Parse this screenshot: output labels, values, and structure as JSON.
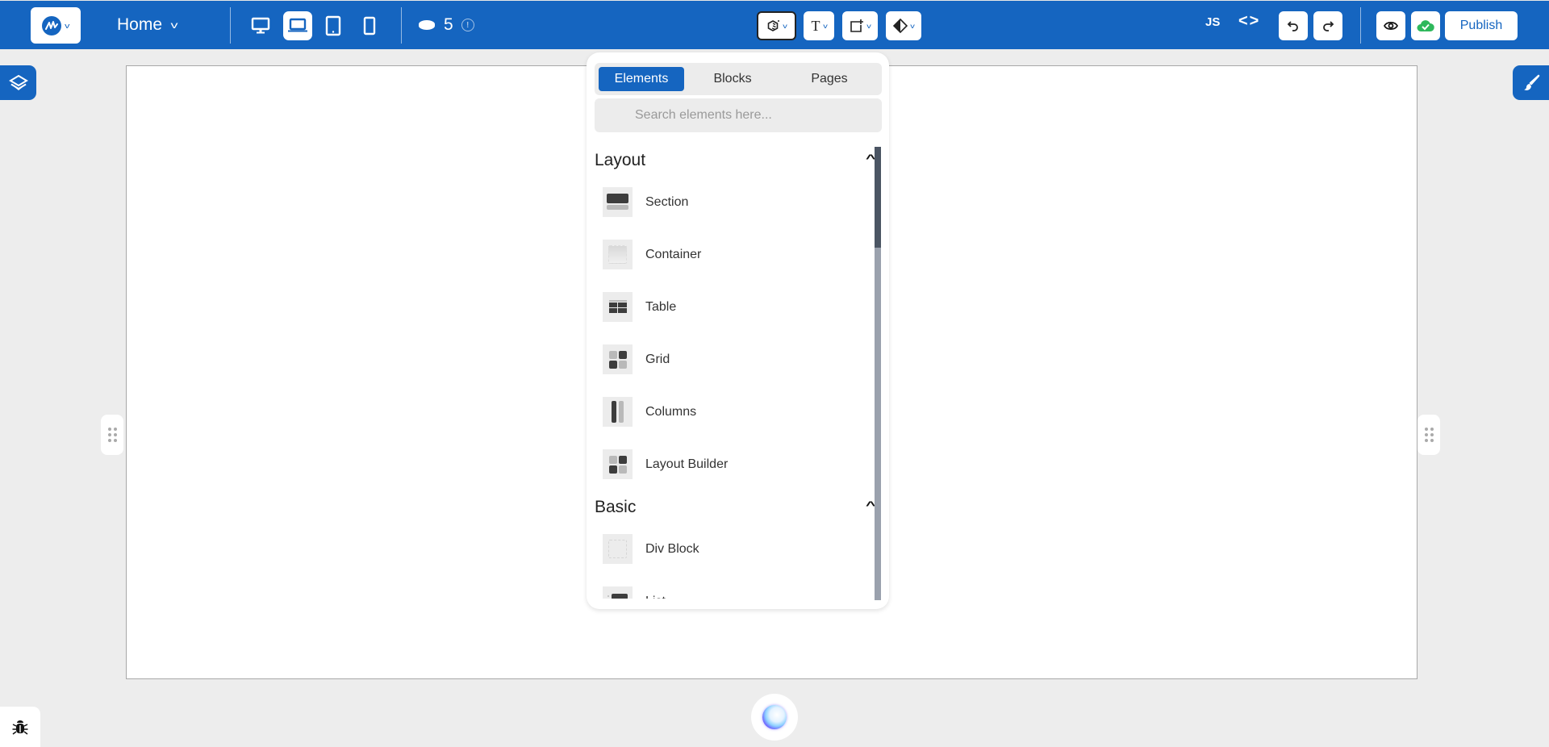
{
  "topbar": {
    "logo_icon": "brand-logo-icon",
    "page_selector": {
      "label": "Home",
      "icon": "chevron-down-icon"
    },
    "devices": [
      {
        "name": "desktop",
        "icon": "desktop-icon",
        "active": false
      },
      {
        "name": "laptop",
        "icon": "laptop-icon",
        "active": true
      },
      {
        "name": "tablet",
        "icon": "tablet-icon",
        "active": false
      },
      {
        "name": "mobile",
        "icon": "mobile-icon",
        "active": false
      }
    ],
    "credits": {
      "value": "5",
      "icon": "coin-icon",
      "info_icon": "info-icon"
    },
    "tools": [
      {
        "name": "add-elements",
        "icon": "elements-icon",
        "active": true
      },
      {
        "name": "typography",
        "icon": "text-icon",
        "active": false
      },
      {
        "name": "add-shape",
        "icon": "add-shape-icon",
        "active": false
      },
      {
        "name": "color",
        "icon": "contrast-icon",
        "active": false
      }
    ],
    "js_label": "JS",
    "code_label": "<>",
    "undo_icon": "undo-icon",
    "redo_icon": "redo-icon",
    "preview_icon": "eye-icon",
    "save_status_icon": "cloud-check-icon",
    "publish_label": "Publish",
    "colors": {
      "brand": "#1565c0",
      "save_ok": "#2eb85c"
    }
  },
  "panel": {
    "tabs": [
      {
        "label": "Elements",
        "active": true
      },
      {
        "label": "Blocks",
        "active": false
      },
      {
        "label": "Pages",
        "active": false
      }
    ],
    "search": {
      "value": "",
      "placeholder": "Search elements here..."
    },
    "sections": [
      {
        "title": "Layout",
        "expanded": true,
        "items": [
          {
            "label": "Section",
            "icon": "section-icon"
          },
          {
            "label": "Container",
            "icon": "container-icon"
          },
          {
            "label": "Table",
            "icon": "table-icon"
          },
          {
            "label": "Grid",
            "icon": "grid-icon"
          },
          {
            "label": "Columns",
            "icon": "columns-icon"
          },
          {
            "label": "Layout Builder",
            "icon": "layout-builder-icon"
          }
        ]
      },
      {
        "title": "Basic",
        "expanded": true,
        "items": [
          {
            "label": "Div Block",
            "icon": "div-block-icon"
          },
          {
            "label": "List",
            "icon": "list-icon"
          }
        ]
      }
    ]
  },
  "side": {
    "left_button_icon": "layers-icon",
    "right_button_icon": "paintbrush-icon"
  },
  "bottom": {
    "debug_icon": "bug-icon",
    "assistant_icon": "ai-assistant-orb-icon"
  }
}
